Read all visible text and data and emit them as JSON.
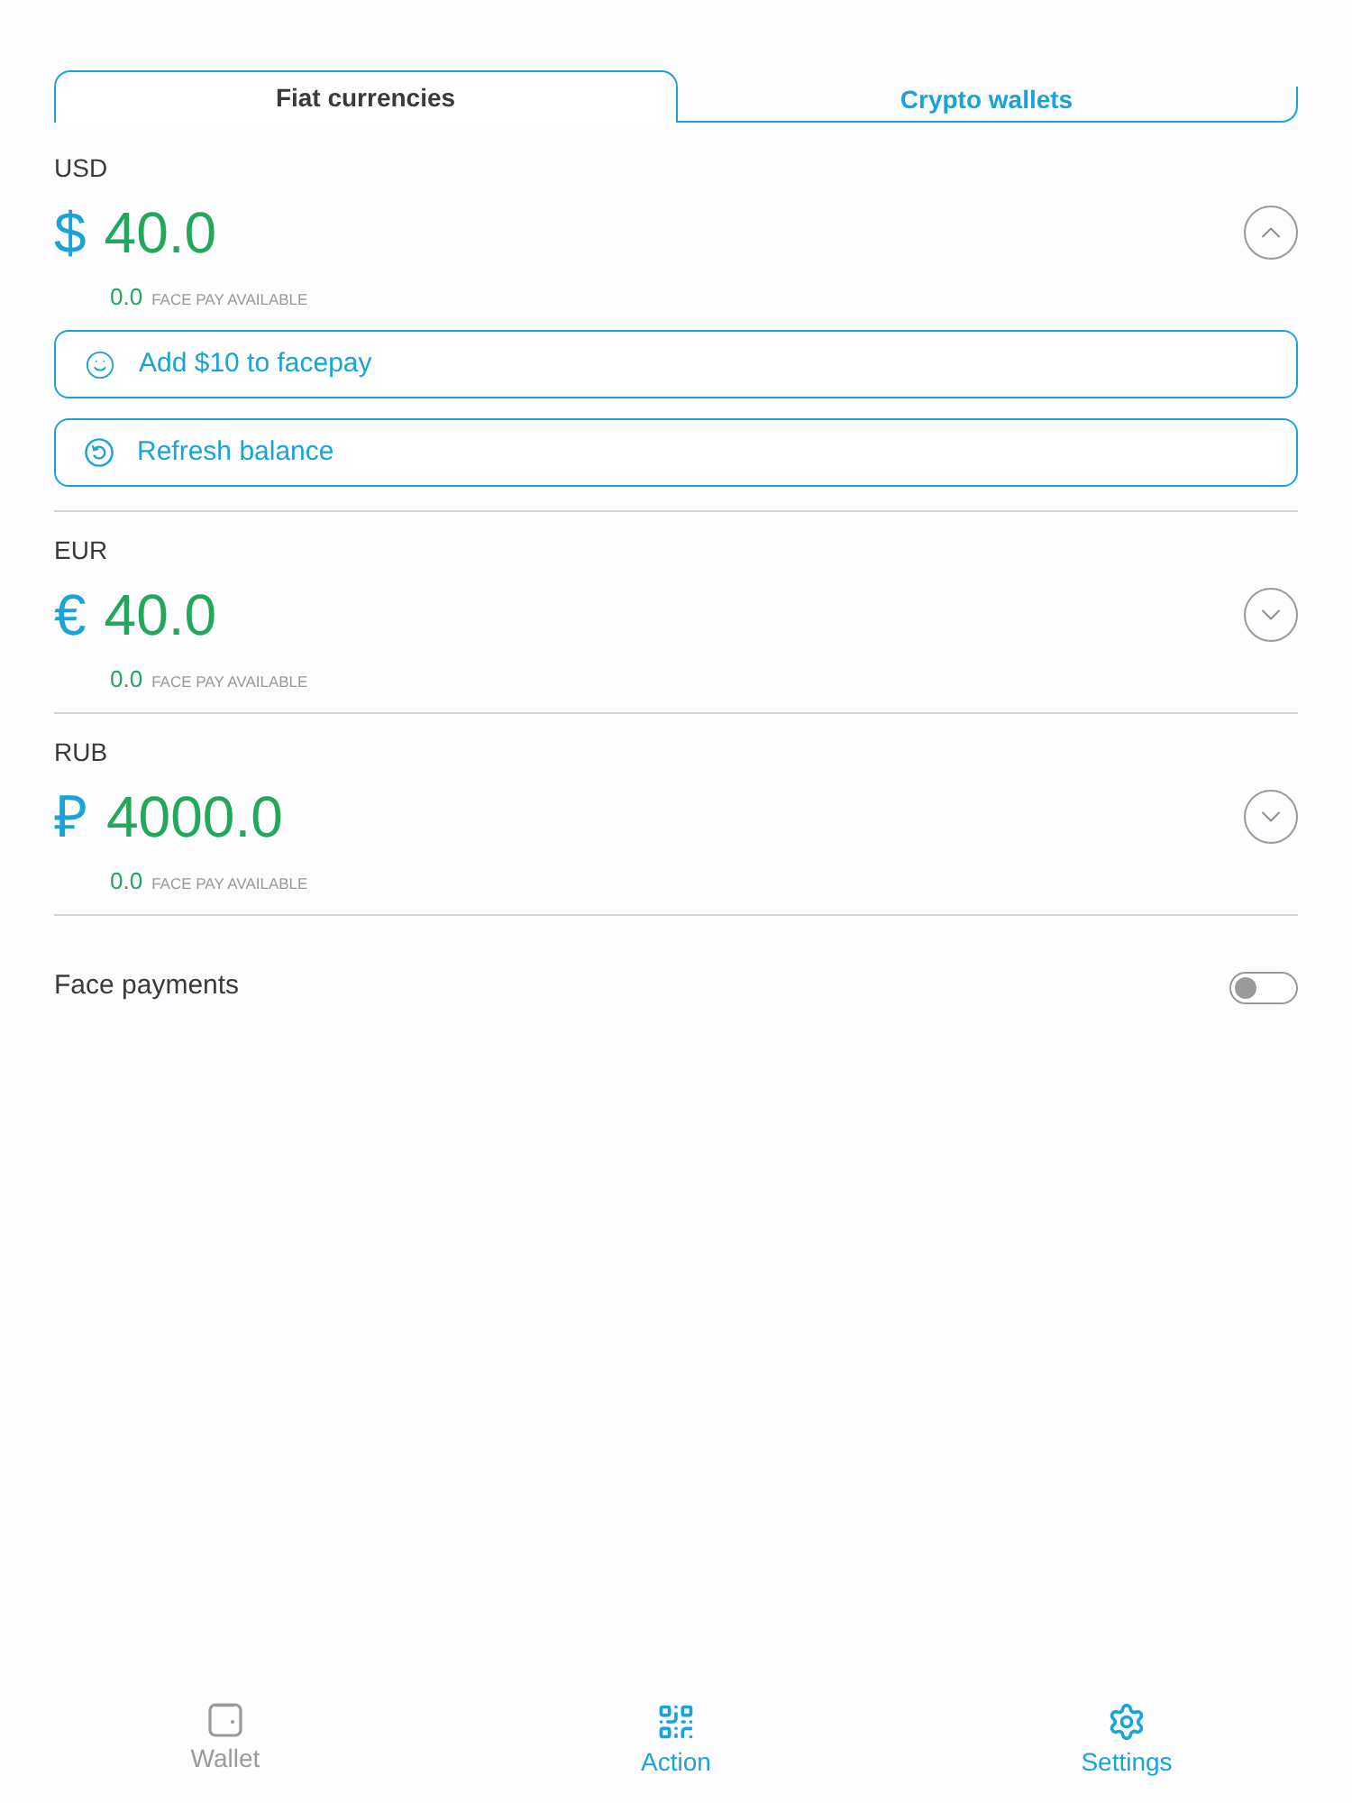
{
  "tabs": [
    {
      "label": "Fiat currencies",
      "selected": true
    },
    {
      "label": "Crypto wallets",
      "selected": false
    }
  ],
  "accounts": [
    {
      "code": "USD",
      "symbol": "$",
      "amount": "40.0",
      "facepay_amount": "0.0",
      "facepay_label": "FACE PAY AVAILABLE",
      "expanded": true,
      "actions": [
        "Add $10 to facepay",
        "Refresh balance"
      ]
    },
    {
      "code": "EUR",
      "symbol": "€",
      "amount": "40.0",
      "facepay_amount": "0.0",
      "facepay_label": "FACE PAY AVAILABLE",
      "expanded": false
    },
    {
      "code": "RUB",
      "symbol": "₽",
      "amount": "4000.0",
      "facepay_amount": "0.0",
      "facepay_label": "FACE PAY AVAILABLE",
      "expanded": false
    }
  ],
  "face_payments": {
    "label": "Face payments",
    "on": false
  },
  "bottom_nav": [
    {
      "label": "Wallet",
      "selected": true
    },
    {
      "label": "Action",
      "selected": false
    },
    {
      "label": "Settings",
      "selected": false
    }
  ]
}
